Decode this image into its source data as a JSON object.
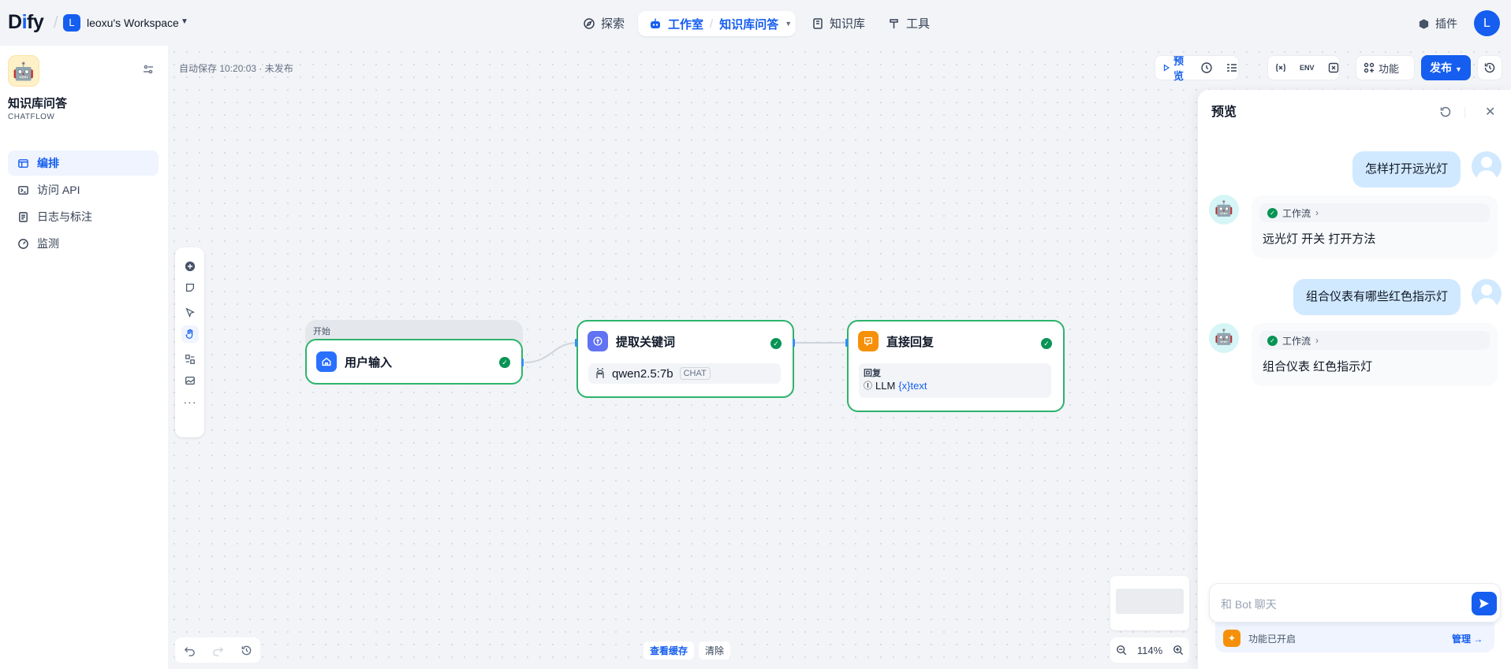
{
  "topbar": {
    "logo_prefix": "D",
    "logo_i": "i",
    "logo_suffix": "fy",
    "workspace_initial": "L",
    "workspace_name": "leoxu's Workspace",
    "nav": {
      "explore": "探索",
      "studio": "工作室",
      "current_app": "知识库问答",
      "knowledge": "知识库",
      "tools": "工具"
    },
    "plugins": "插件",
    "user_initial": "L"
  },
  "sidebar": {
    "app_icon": "🤖",
    "app_name": "知识库问答",
    "app_type": "CHATFLOW",
    "items": [
      {
        "label": "编排",
        "icon": "layout-icon"
      },
      {
        "label": "访问 API",
        "icon": "terminal-icon"
      },
      {
        "label": "日志与标注",
        "icon": "file-list-icon"
      },
      {
        "label": "监测",
        "icon": "dashboard-icon"
      }
    ]
  },
  "canvas": {
    "autosave": "自动保存 10:20:03 · 未发布",
    "toolbar": {
      "preview": "预览",
      "features": "功能",
      "env": "ENV",
      "publish": "发布"
    },
    "nodes": {
      "start": {
        "group_label": "开始",
        "title": "用户输入"
      },
      "llm": {
        "title": "提取关键词",
        "model": "qwen2.5:7b",
        "model_tag": "CHAT"
      },
      "answer": {
        "title": "直接回复",
        "reply_label": "回复",
        "source": "LLM",
        "var": "{x}text"
      }
    },
    "cache": {
      "view": "查看缓存",
      "clear": "清除"
    },
    "zoom": "114%"
  },
  "preview": {
    "title": "预览",
    "messages": [
      {
        "role": "user",
        "text": "怎样打开远光灯"
      },
      {
        "role": "bot",
        "workflow": "工作流",
        "text": "远光灯 开关 打开方法"
      },
      {
        "role": "user",
        "text": "组合仪表有哪些红色指示灯"
      },
      {
        "role": "bot",
        "workflow": "工作流",
        "text": "组合仪表 红色指示灯"
      }
    ],
    "input_placeholder": "和 Bot 聊天",
    "features_enabled": "功能已开启",
    "manage": "管理 →"
  },
  "colors": {
    "accent": "#155eef",
    "success": "#079455",
    "node_border": "#2db36b"
  }
}
